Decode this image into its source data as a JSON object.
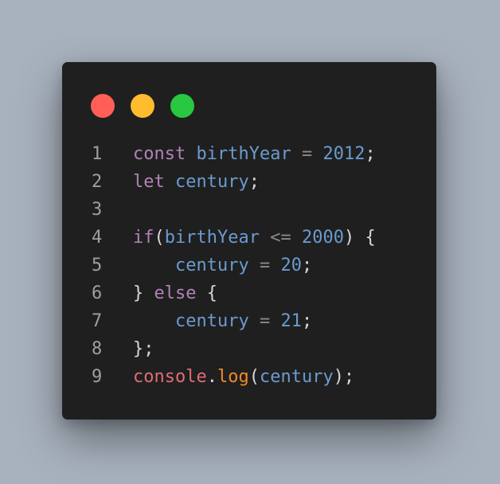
{
  "window": {
    "controls": [
      {
        "name": "close",
        "color": "#ff5f57"
      },
      {
        "name": "minimize",
        "color": "#febc2e"
      },
      {
        "name": "maximize",
        "color": "#28c840"
      }
    ]
  },
  "code": {
    "lines": [
      {
        "number": "1",
        "tokens": [
          {
            "text": "const",
            "kind": "kw"
          },
          {
            "text": " ",
            "kind": "punc"
          },
          {
            "text": "birthYear",
            "kind": "var"
          },
          {
            "text": " ",
            "kind": "punc"
          },
          {
            "text": "=",
            "kind": "op"
          },
          {
            "text": " ",
            "kind": "punc"
          },
          {
            "text": "2012",
            "kind": "num"
          },
          {
            "text": ";",
            "kind": "punc"
          }
        ]
      },
      {
        "number": "2",
        "tokens": [
          {
            "text": "let",
            "kind": "kw"
          },
          {
            "text": " ",
            "kind": "punc"
          },
          {
            "text": "century",
            "kind": "var"
          },
          {
            "text": ";",
            "kind": "punc"
          }
        ]
      },
      {
        "number": "3",
        "tokens": []
      },
      {
        "number": "4",
        "tokens": [
          {
            "text": "if",
            "kind": "kw"
          },
          {
            "text": "(",
            "kind": "punc"
          },
          {
            "text": "birthYear",
            "kind": "var"
          },
          {
            "text": " ",
            "kind": "punc"
          },
          {
            "text": "<=",
            "kind": "op"
          },
          {
            "text": " ",
            "kind": "punc"
          },
          {
            "text": "2000",
            "kind": "num"
          },
          {
            "text": ") {",
            "kind": "punc"
          }
        ]
      },
      {
        "number": "5",
        "tokens": [
          {
            "text": "    ",
            "kind": "punc"
          },
          {
            "text": "century",
            "kind": "var"
          },
          {
            "text": " ",
            "kind": "punc"
          },
          {
            "text": "=",
            "kind": "op"
          },
          {
            "text": " ",
            "kind": "punc"
          },
          {
            "text": "20",
            "kind": "num"
          },
          {
            "text": ";",
            "kind": "punc"
          }
        ]
      },
      {
        "number": "6",
        "tokens": [
          {
            "text": "} ",
            "kind": "punc"
          },
          {
            "text": "else",
            "kind": "kw"
          },
          {
            "text": " {",
            "kind": "punc"
          }
        ]
      },
      {
        "number": "7",
        "tokens": [
          {
            "text": "    ",
            "kind": "punc"
          },
          {
            "text": "century",
            "kind": "var"
          },
          {
            "text": " ",
            "kind": "punc"
          },
          {
            "text": "=",
            "kind": "op"
          },
          {
            "text": " ",
            "kind": "punc"
          },
          {
            "text": "21",
            "kind": "num"
          },
          {
            "text": ";",
            "kind": "punc"
          }
        ]
      },
      {
        "number": "8",
        "tokens": [
          {
            "text": "};",
            "kind": "punc"
          }
        ]
      },
      {
        "number": "9",
        "tokens": [
          {
            "text": "console",
            "kind": "obj"
          },
          {
            "text": ".",
            "kind": "punc"
          },
          {
            "text": "log",
            "kind": "fn"
          },
          {
            "text": "(",
            "kind": "punc"
          },
          {
            "text": "century",
            "kind": "var"
          },
          {
            "text": ");",
            "kind": "punc"
          }
        ]
      }
    ]
  }
}
